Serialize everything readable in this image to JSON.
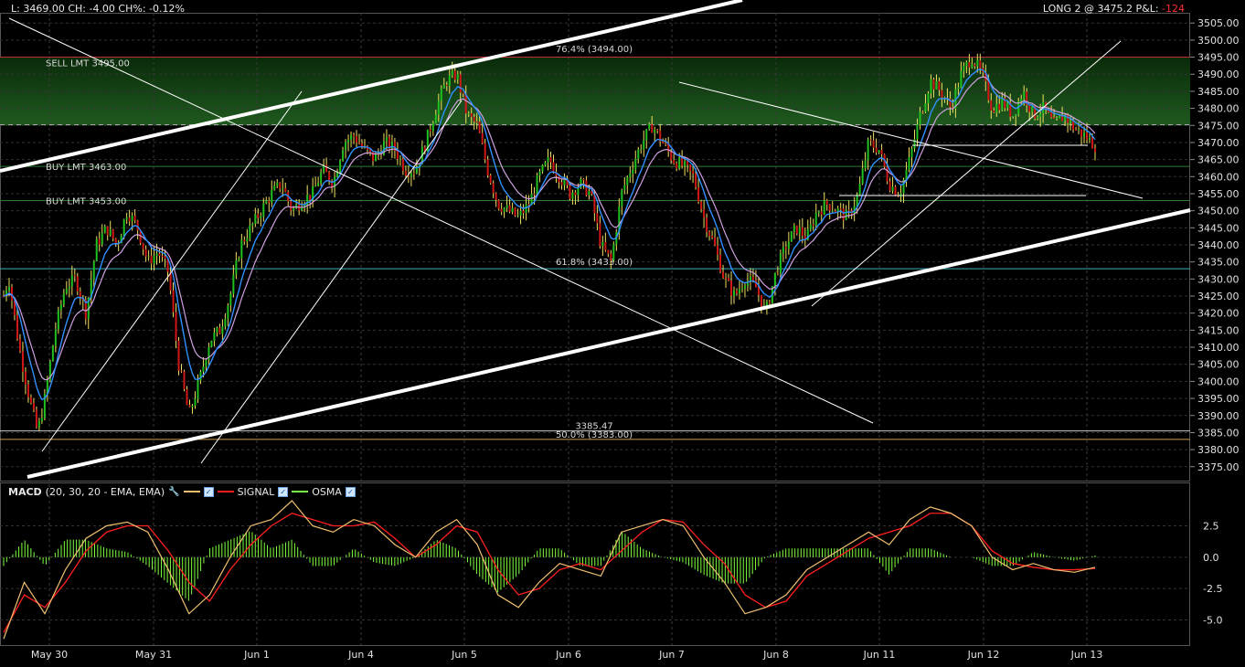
{
  "header": {
    "quote": "L: 3469.00 CH: -4.00 CH%: -0.12%",
    "position_prefix": "LONG 2 @ 3475.2 P&L: ",
    "position_pnl": "-124"
  },
  "macd_panel": {
    "title": "MACD",
    "params": "(20, 30, 20 - EMA, EMA)",
    "signal_label": "SIGNAL",
    "osma_label": "OSMA",
    "macd_color": "#f0c070",
    "signal_color": "#ff2020",
    "osma_color": "#7fff3f"
  },
  "annotations": {
    "sell_lmt": "SELL LMT 3495.00",
    "buy_lmt_1": "BUY LMT 3463.00",
    "buy_lmt_2": "BUY LMT 3453.00",
    "fib_764": "76.4% (3494.00)",
    "fib_618": "61.8% (3433.00)",
    "fib_500": "50.0% (3383.00)",
    "level_3385": "3385.47"
  },
  "chart_data": [
    {
      "type": "candlestick",
      "price_ticks": [
        "3505.00",
        "3500.00",
        "3495.00",
        "3490.00",
        "3485.00",
        "3480.00",
        "3475.00",
        "3470.00",
        "3465.00",
        "3460.00",
        "3455.00",
        "3450.00",
        "3445.00",
        "3440.00",
        "3435.00",
        "3430.00",
        "3425.00",
        "3420.00",
        "3415.00",
        "3410.00",
        "3405.00",
        "3400.00",
        "3395.00",
        "3390.00",
        "3385.00",
        "3380.00",
        "3375.00"
      ],
      "ylim": [
        3372,
        3508
      ],
      "x_labels": [
        "May 30",
        "May 31",
        "Jun 1",
        "Jun 4",
        "Jun 5",
        "Jun 6",
        "Jun 7",
        "Jun 8",
        "Jun 11",
        "Jun 12",
        "Jun 13"
      ],
      "last_price": 3469.0,
      "order_levels": [
        {
          "label": "SELL LMT 3495.00",
          "price": 3495.0,
          "color": "#c03030"
        },
        {
          "label": "BUY LMT 3463.00",
          "price": 3463.0,
          "color": "#2f7a2f"
        },
        {
          "label": "BUY LMT 3453.00",
          "price": 3453.0,
          "color": "#2f7a2f"
        }
      ],
      "horizontal_levels": [
        {
          "price": 3475.2,
          "style": "dashed",
          "color": "#aaaaaa"
        },
        {
          "price": 3433.0,
          "color": "#40b0c0"
        },
        {
          "price": 3385.47,
          "color": "#cccccc"
        },
        {
          "price": 3383.0,
          "color": "#d0a050"
        }
      ],
      "green_zone": [
        3475.0,
        3495.0
      ],
      "price_path": [
        [
          0,
          3425
        ],
        [
          0.5,
          3430
        ],
        [
          1.5,
          3410
        ],
        [
          2.5,
          3395
        ],
        [
          3.3,
          3385
        ],
        [
          4,
          3395
        ],
        [
          5,
          3415
        ],
        [
          6,
          3428
        ],
        [
          7,
          3430
        ],
        [
          8,
          3420
        ],
        [
          9,
          3440
        ],
        [
          10,
          3445
        ],
        [
          11,
          3440
        ],
        [
          12,
          3450
        ],
        [
          13,
          3445
        ],
        [
          14,
          3435
        ],
        [
          15,
          3438
        ],
        [
          16,
          3432
        ],
        [
          17,
          3405
        ],
        [
          18,
          3390
        ],
        [
          19,
          3400
        ],
        [
          20,
          3412
        ],
        [
          21,
          3415
        ],
        [
          22,
          3425
        ],
        [
          23,
          3440
        ],
        [
          24,
          3445
        ],
        [
          25,
          3450
        ],
        [
          26,
          3455
        ],
        [
          27,
          3458
        ],
        [
          28,
          3450
        ],
        [
          29,
          3453
        ],
        [
          30,
          3455
        ],
        [
          31,
          3462
        ],
        [
          32,
          3458
        ],
        [
          33,
          3470
        ],
        [
          34,
          3472
        ],
        [
          35,
          3468
        ],
        [
          36,
          3465
        ],
        [
          37,
          3470
        ],
        [
          38,
          3468
        ],
        [
          39,
          3462
        ],
        [
          40,
          3462
        ],
        [
          41,
          3470
        ],
        [
          42,
          3480
        ],
        [
          43,
          3488
        ],
        [
          44,
          3490
        ],
        [
          45,
          3478
        ],
        [
          46,
          3475
        ],
        [
          47,
          3462
        ],
        [
          48,
          3452
        ],
        [
          49,
          3450
        ],
        [
          50,
          3448
        ],
        [
          51,
          3452
        ],
        [
          52,
          3460
        ],
        [
          53,
          3465
        ],
        [
          54,
          3460
        ],
        [
          55,
          3455
        ],
        [
          56,
          3458
        ],
        [
          57,
          3455
        ],
        [
          58,
          3440
        ],
        [
          59,
          3435
        ],
        [
          60,
          3455
        ],
        [
          61,
          3463
        ],
        [
          62,
          3470
        ],
        [
          63,
          3475
        ],
        [
          64,
          3470
        ],
        [
          65,
          3465
        ],
        [
          66,
          3463
        ],
        [
          67,
          3460
        ],
        [
          68,
          3448
        ],
        [
          69,
          3440
        ],
        [
          70,
          3430
        ],
        [
          71,
          3425
        ],
        [
          72,
          3430
        ],
        [
          73,
          3428
        ],
        [
          74,
          3420
        ],
        [
          75,
          3432
        ],
        [
          76,
          3440
        ],
        [
          77,
          3445
        ],
        [
          78,
          3442
        ],
        [
          79,
          3450
        ],
        [
          80,
          3452
        ],
        [
          81,
          3450
        ],
        [
          82,
          3448
        ],
        [
          83,
          3455
        ],
        [
          84,
          3470
        ],
        [
          85,
          3468
        ],
        [
          86,
          3458
        ],
        [
          87,
          3455
        ],
        [
          88,
          3465
        ],
        [
          89,
          3478
        ],
        [
          90,
          3488
        ],
        [
          91,
          3485
        ],
        [
          92,
          3480
        ],
        [
          93,
          3490
        ],
        [
          94,
          3495
        ],
        [
          95,
          3490
        ],
        [
          96,
          3480
        ],
        [
          97,
          3482
        ],
        [
          98,
          3478
        ],
        [
          99,
          3485
        ],
        [
          100,
          3478
        ],
        [
          101,
          3480
        ],
        [
          102,
          3475
        ],
        [
          103,
          3478
        ],
        [
          104,
          3474
        ],
        [
          105,
          3472
        ],
        [
          106,
          3469
        ]
      ]
    },
    {
      "type": "macd",
      "yticks": [
        "2.5",
        "0.0",
        "-2.5",
        "-5.0"
      ],
      "ylim": [
        -7,
        4.5
      ],
      "macd_path": [
        [
          0,
          -6.5
        ],
        [
          2,
          -2
        ],
        [
          4,
          -4.5
        ],
        [
          6,
          -1
        ],
        [
          8,
          1.5
        ],
        [
          10,
          2.5
        ],
        [
          12,
          2.8
        ],
        [
          14,
          2
        ],
        [
          16,
          -1
        ],
        [
          18,
          -4.5
        ],
        [
          20,
          -3
        ],
        [
          22,
          0
        ],
        [
          24,
          2.5
        ],
        [
          26,
          3
        ],
        [
          28,
          4.5
        ],
        [
          30,
          2.5
        ],
        [
          32,
          2
        ],
        [
          34,
          3
        ],
        [
          36,
          2.5
        ],
        [
          38,
          1
        ],
        [
          40,
          0
        ],
        [
          42,
          2
        ],
        [
          44,
          3
        ],
        [
          46,
          1
        ],
        [
          48,
          -3
        ],
        [
          50,
          -4
        ],
        [
          52,
          -2
        ],
        [
          54,
          -0.5
        ],
        [
          56,
          -1
        ],
        [
          58,
          -1.5
        ],
        [
          60,
          2
        ],
        [
          62,
          2.5
        ],
        [
          64,
          3
        ],
        [
          66,
          2.5
        ],
        [
          68,
          0
        ],
        [
          70,
          -2
        ],
        [
          72,
          -4.5
        ],
        [
          74,
          -4
        ],
        [
          76,
          -3
        ],
        [
          78,
          -1
        ],
        [
          80,
          0
        ],
        [
          82,
          1
        ],
        [
          84,
          2
        ],
        [
          86,
          1
        ],
        [
          88,
          3
        ],
        [
          90,
          4
        ],
        [
          92,
          3.5
        ],
        [
          94,
          2.5
        ],
        [
          96,
          0
        ],
        [
          98,
          -1
        ],
        [
          100,
          -0.5
        ],
        [
          102,
          -1
        ],
        [
          104,
          -1.2
        ],
        [
          106,
          -0.8
        ]
      ],
      "signal_path": [
        [
          0,
          -6
        ],
        [
          2,
          -3
        ],
        [
          4,
          -4
        ],
        [
          6,
          -2
        ],
        [
          8,
          0.5
        ],
        [
          10,
          2
        ],
        [
          12,
          2.5
        ],
        [
          14,
          2.5
        ],
        [
          16,
          0.5
        ],
        [
          18,
          -2
        ],
        [
          20,
          -3.5
        ],
        [
          22,
          -1
        ],
        [
          24,
          1
        ],
        [
          26,
          2.5
        ],
        [
          28,
          3.5
        ],
        [
          30,
          3
        ],
        [
          32,
          2.5
        ],
        [
          34,
          2.5
        ],
        [
          36,
          2.8
        ],
        [
          38,
          1.5
        ],
        [
          40,
          0
        ],
        [
          42,
          1
        ],
        [
          44,
          2.5
        ],
        [
          46,
          2
        ],
        [
          48,
          -1
        ],
        [
          50,
          -3
        ],
        [
          52,
          -2.5
        ],
        [
          54,
          -1
        ],
        [
          56,
          -0.5
        ],
        [
          58,
          -1
        ],
        [
          60,
          0.5
        ],
        [
          62,
          2
        ],
        [
          64,
          3
        ],
        [
          66,
          2.8
        ],
        [
          68,
          1
        ],
        [
          70,
          -0.5
        ],
        [
          72,
          -3
        ],
        [
          74,
          -4
        ],
        [
          76,
          -3.5
        ],
        [
          78,
          -1.5
        ],
        [
          80,
          -0.5
        ],
        [
          82,
          0.5
        ],
        [
          84,
          1.5
        ],
        [
          86,
          2
        ],
        [
          88,
          2.5
        ],
        [
          90,
          3.5
        ],
        [
          92,
          3.5
        ],
        [
          94,
          2.5
        ],
        [
          96,
          0.5
        ],
        [
          98,
          -0.5
        ],
        [
          100,
          -0.8
        ],
        [
          102,
          -1
        ],
        [
          104,
          -1
        ],
        [
          106,
          -0.9
        ]
      ]
    }
  ]
}
